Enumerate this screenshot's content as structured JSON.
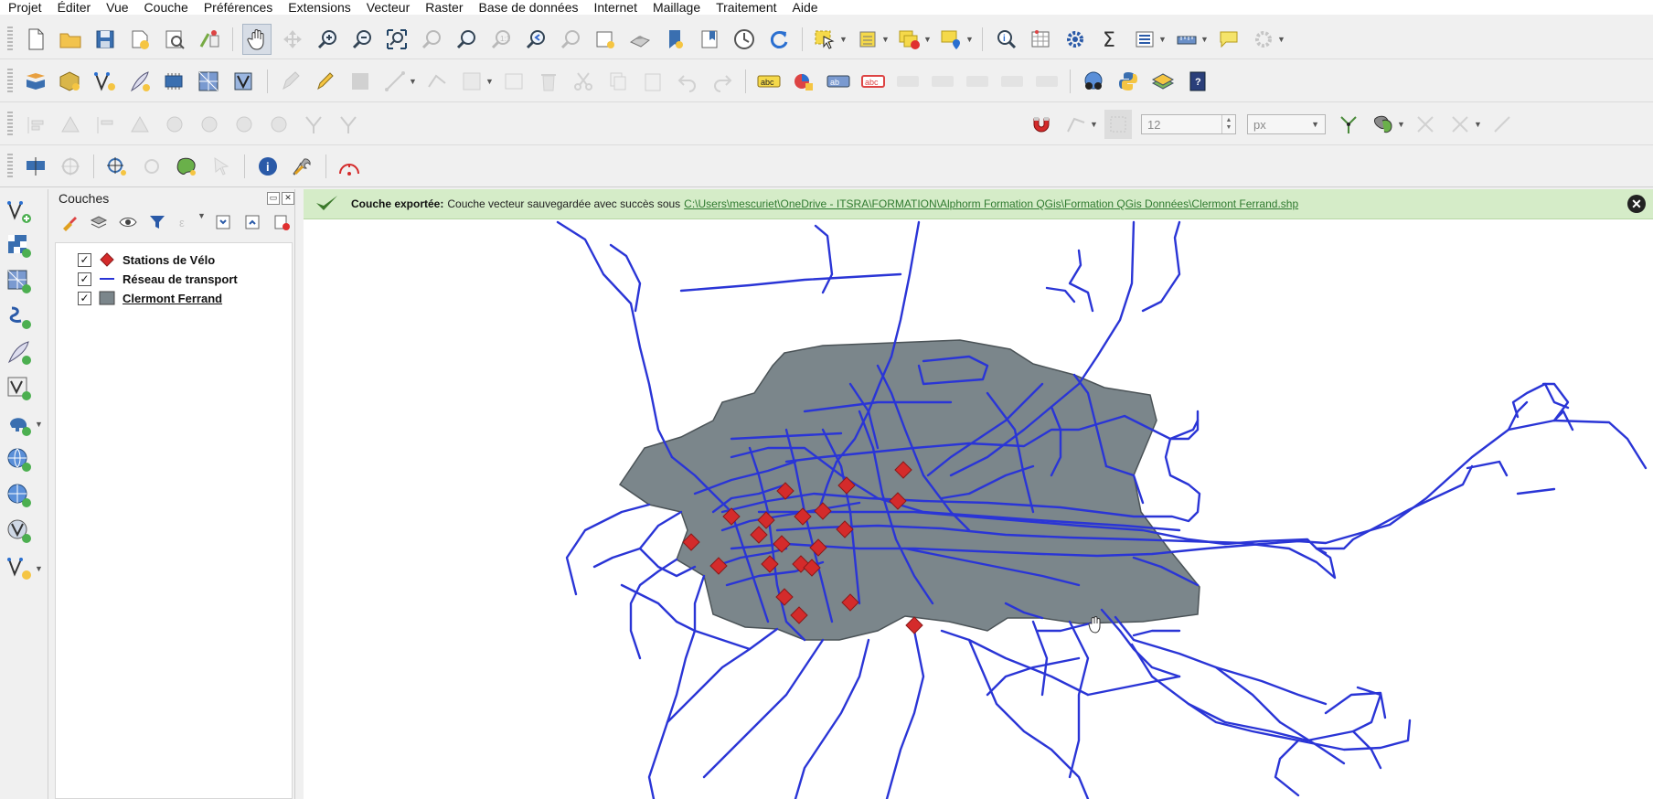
{
  "menu": [
    "Projet",
    "Éditer",
    "Vue",
    "Couche",
    "Préférences",
    "Extensions",
    "Vecteur",
    "Raster",
    "Base de données",
    "Internet",
    "Maillage",
    "Traitement",
    "Aide"
  ],
  "snapping": {
    "tolerance_value": "12",
    "units": "px"
  },
  "layers_panel": {
    "title": "Couches",
    "layers": [
      {
        "name": "Stations de Vélo",
        "checked": true,
        "symbol": "red-diamond-icon",
        "underline": false
      },
      {
        "name": "Réseau de transport",
        "checked": true,
        "symbol": "blue-line-icon",
        "underline": false
      },
      {
        "name": "Clermont Ferrand",
        "checked": true,
        "symbol": "grey-fill-icon",
        "underline": true
      }
    ]
  },
  "message_bar": {
    "title": "Couche exportée:",
    "text": "Couche vecteur sauvegardée avec succès sous",
    "link": "C:\\Users\\mescuriet\\OneDrive - ITSRA\\FORMATION\\Alphorm Formation QGis\\Formation QGis Données\\Clermont Ferrand.shp"
  },
  "colors": {
    "polygon_fill": "#7b868b",
    "network": "#2a35d6",
    "station": "#d42b2b",
    "message_bg": "#d5ecc8"
  },
  "check_glyph": "✓",
  "close_glyph": "✕"
}
